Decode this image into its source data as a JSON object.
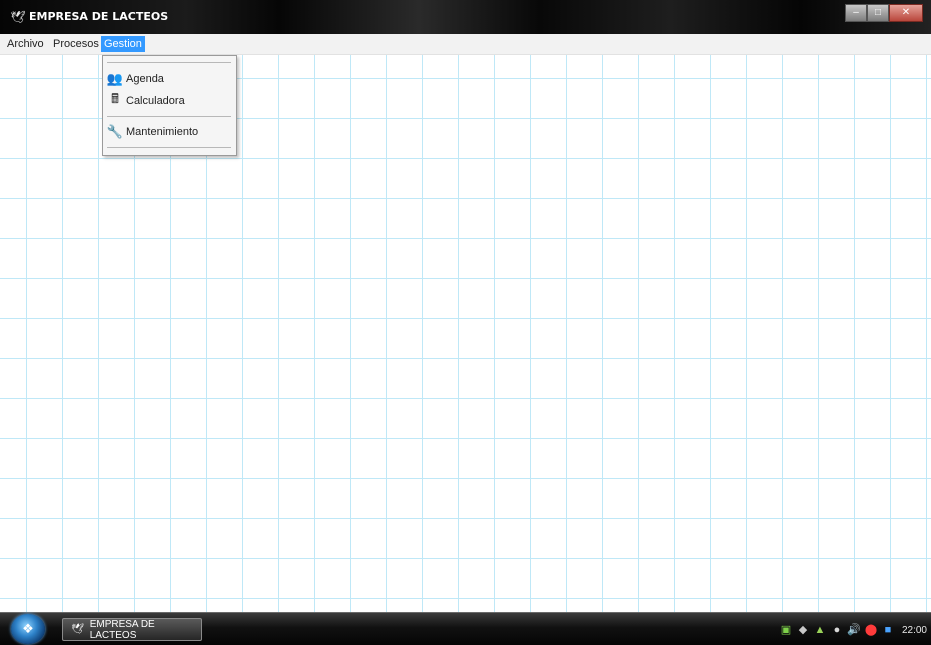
{
  "window": {
    "title": "EMPRESA DE LACTEOS",
    "title_icon": "bird-icon",
    "controls": [
      "minimize-icon",
      "maximize-icon",
      "close-icon"
    ]
  },
  "menubar": {
    "items": [
      {
        "label": "Archivo"
      },
      {
        "label": "Procesos"
      },
      {
        "label": "Gestion"
      }
    ],
    "active_index": 2
  },
  "dropdown": {
    "items": [
      {
        "label": "Agenda",
        "icon": "people-icon"
      },
      {
        "label": "Calculadora",
        "icon": "calculator-icon"
      },
      {
        "label": "Mantenimiento",
        "icon": "tools-icon"
      }
    ]
  },
  "taskbar": {
    "start_icon": "windows-logo-icon",
    "task_label": "EMPRESA DE LACTEOS",
    "clock": "22:00",
    "tray_icons": [
      "network-icon",
      "shield-icon",
      "chart-icon",
      "user-icon",
      "volume-icon",
      "antivirus-icon",
      "display-icon"
    ]
  },
  "colors": {
    "grid_line": "#bfe8f7",
    "menu_highlight": "#3399ff",
    "titlebar": "#050505"
  }
}
